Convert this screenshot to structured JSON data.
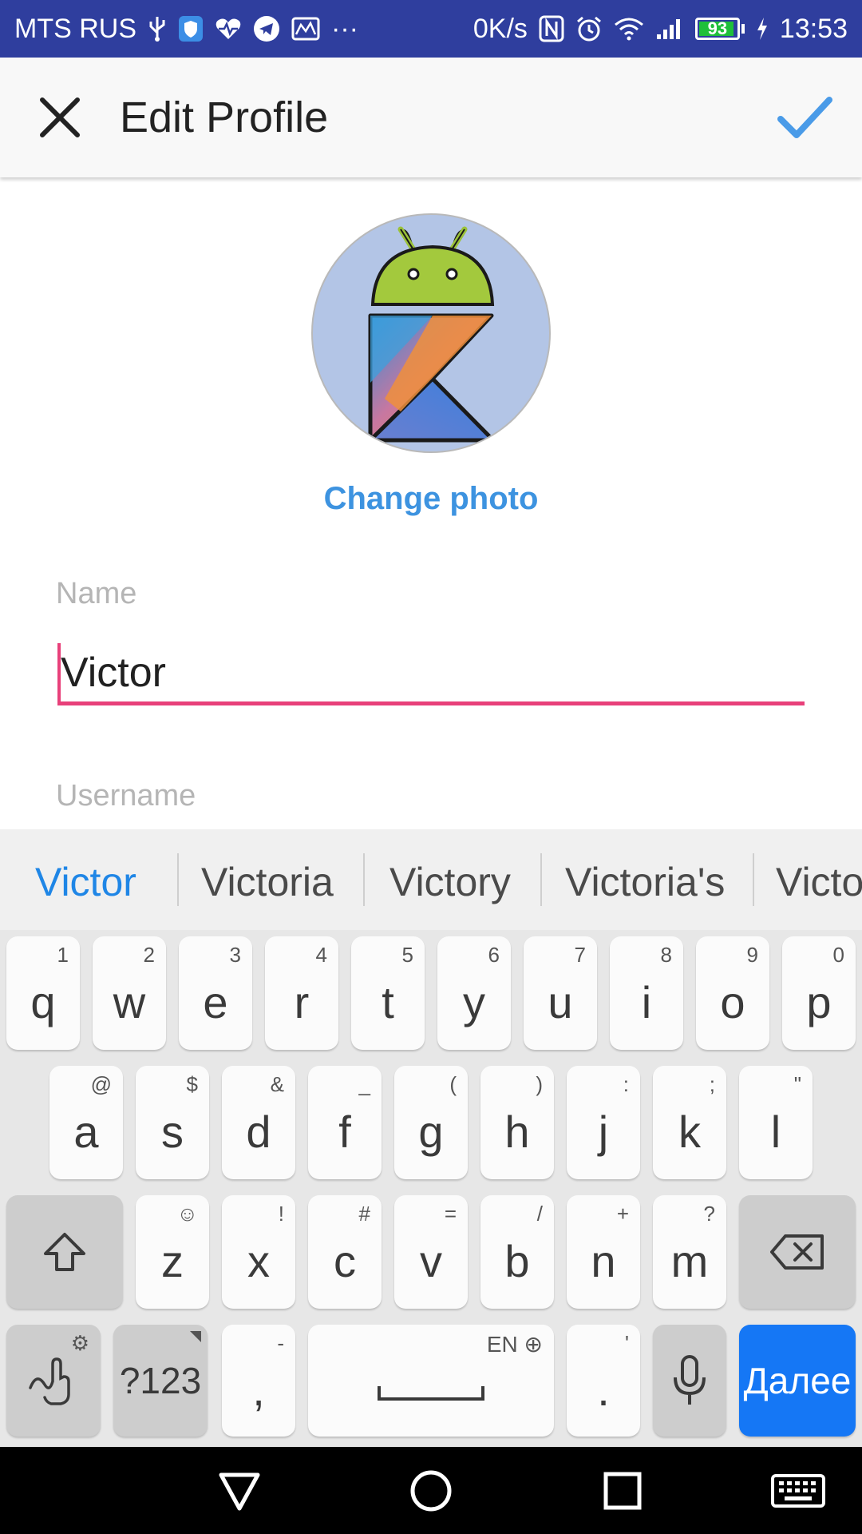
{
  "status_bar": {
    "carrier": "MTS RUS",
    "more": "···",
    "net_speed": "0K/s",
    "battery_level": "93",
    "battery_fraction": 0.93,
    "time": "13:53",
    "icons": [
      "usb-icon",
      "shield-icon",
      "health-icon",
      "telegram-icon",
      "mail-icon",
      "nfc-icon",
      "alarm-icon",
      "wifi-icon",
      "signal-icon",
      "battery-icon",
      "charging-icon"
    ]
  },
  "toolbar": {
    "title": "Edit Profile",
    "close_icon": "close-icon",
    "confirm_icon": "check-icon",
    "confirm_color": "#4a9be8"
  },
  "profile": {
    "change_photo": "Change photo",
    "name_label": "Name",
    "name_value": "Victor",
    "username_label": "Username",
    "accent_color": "#e8407a",
    "link_color": "#3d93e0"
  },
  "keyboard": {
    "suggestions": [
      "Victor",
      "Victoria",
      "Victory",
      "Victoria's",
      "Victo"
    ],
    "row1": [
      {
        "main": "q",
        "sec": "1"
      },
      {
        "main": "w",
        "sec": "2"
      },
      {
        "main": "e",
        "sec": "3"
      },
      {
        "main": "r",
        "sec": "4"
      },
      {
        "main": "t",
        "sec": "5"
      },
      {
        "main": "y",
        "sec": "6"
      },
      {
        "main": "u",
        "sec": "7"
      },
      {
        "main": "i",
        "sec": "8"
      },
      {
        "main": "o",
        "sec": "9"
      },
      {
        "main": "p",
        "sec": "0"
      }
    ],
    "row2": [
      {
        "main": "a",
        "sec": "@"
      },
      {
        "main": "s",
        "sec": "$"
      },
      {
        "main": "d",
        "sec": "&"
      },
      {
        "main": "f",
        "sec": "_"
      },
      {
        "main": "g",
        "sec": "("
      },
      {
        "main": "h",
        "sec": ")"
      },
      {
        "main": "j",
        "sec": ":"
      },
      {
        "main": "k",
        "sec": ";"
      },
      {
        "main": "l",
        "sec": "\""
      }
    ],
    "row3": [
      {
        "main": "z",
        "sec": "☺"
      },
      {
        "main": "x",
        "sec": "!"
      },
      {
        "main": "c",
        "sec": "#"
      },
      {
        "main": "v",
        "sec": "="
      },
      {
        "main": "b",
        "sec": "/"
      },
      {
        "main": "n",
        "sec": "+"
      },
      {
        "main": "m",
        "sec": "?"
      }
    ],
    "symbols_label": "?123",
    "comma": ",",
    "comma_sec": "-",
    "period": ".",
    "period_sec": "'",
    "space_label": "EN",
    "enter_label": "Далее",
    "enter_color": "#1577f5"
  }
}
